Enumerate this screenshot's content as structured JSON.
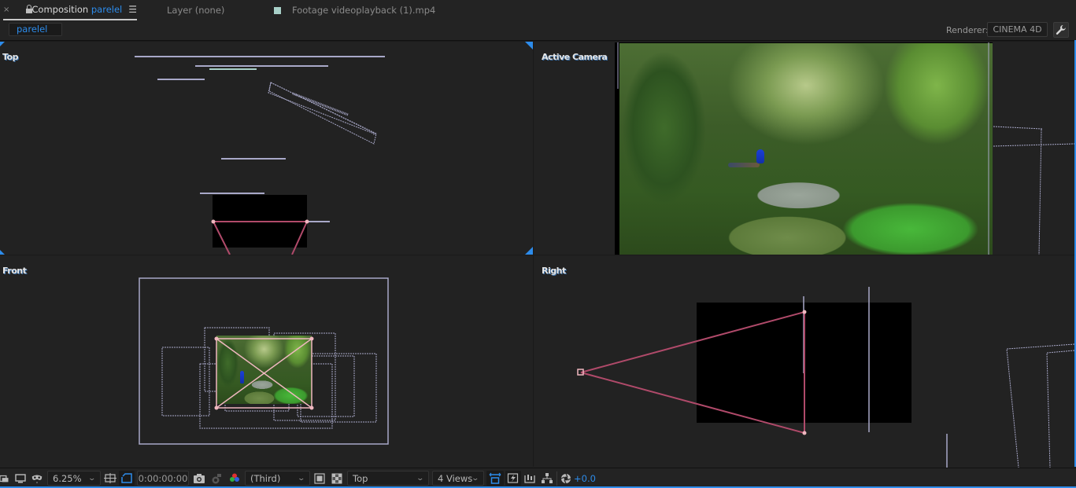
{
  "tabs": {
    "composition": {
      "close_glyph": "×",
      "label_color": "#b09a78",
      "prefix": "Composition",
      "name": "parelel",
      "menu_glyph": "☰"
    },
    "layer": {
      "label": "Layer  (none)"
    },
    "footage": {
      "label_color": "#a8d0c8",
      "label": "Footage  videoplayback (1).mp4"
    }
  },
  "subbar": {
    "comp_chip": "parelel",
    "renderer_label": "Renderer:",
    "renderer_value": "CINEMA 4D",
    "renderer_settings_icon": "wrench-icon"
  },
  "viewports": {
    "top": {
      "label": "Top"
    },
    "active_camera": {
      "label": "Active Camera"
    },
    "front": {
      "label": "Front"
    },
    "right": {
      "label": "Right"
    }
  },
  "toolbar": {
    "magnification": "6.25%",
    "timecode": "0:00:00:00",
    "view_selector": "(Third)",
    "view_name": "Top",
    "layout": "4 Views",
    "exposure": "+0.0",
    "icons": [
      "always-preview-icon",
      "monitor-icon",
      "mask-visibility-icon",
      "region-of-interest-icon",
      "toggle-transparency-grid-icon",
      "snapshot-icon",
      "show-snapshot-icon",
      "channel-rgb-icon",
      "toggle-view-mask-icon",
      "checkerboard-icon",
      "share-view-icon",
      "fast-previews-icon",
      "timeline-icon",
      "flowchart-icon",
      "reset-exposure-icon"
    ]
  },
  "colors": {
    "accent": "#2d8ceb",
    "camera_wire": "#b04a6a",
    "camera_handle": "#f0b8c0",
    "layer_wire": "#a8a8c8",
    "panel_bg": "#222222"
  }
}
